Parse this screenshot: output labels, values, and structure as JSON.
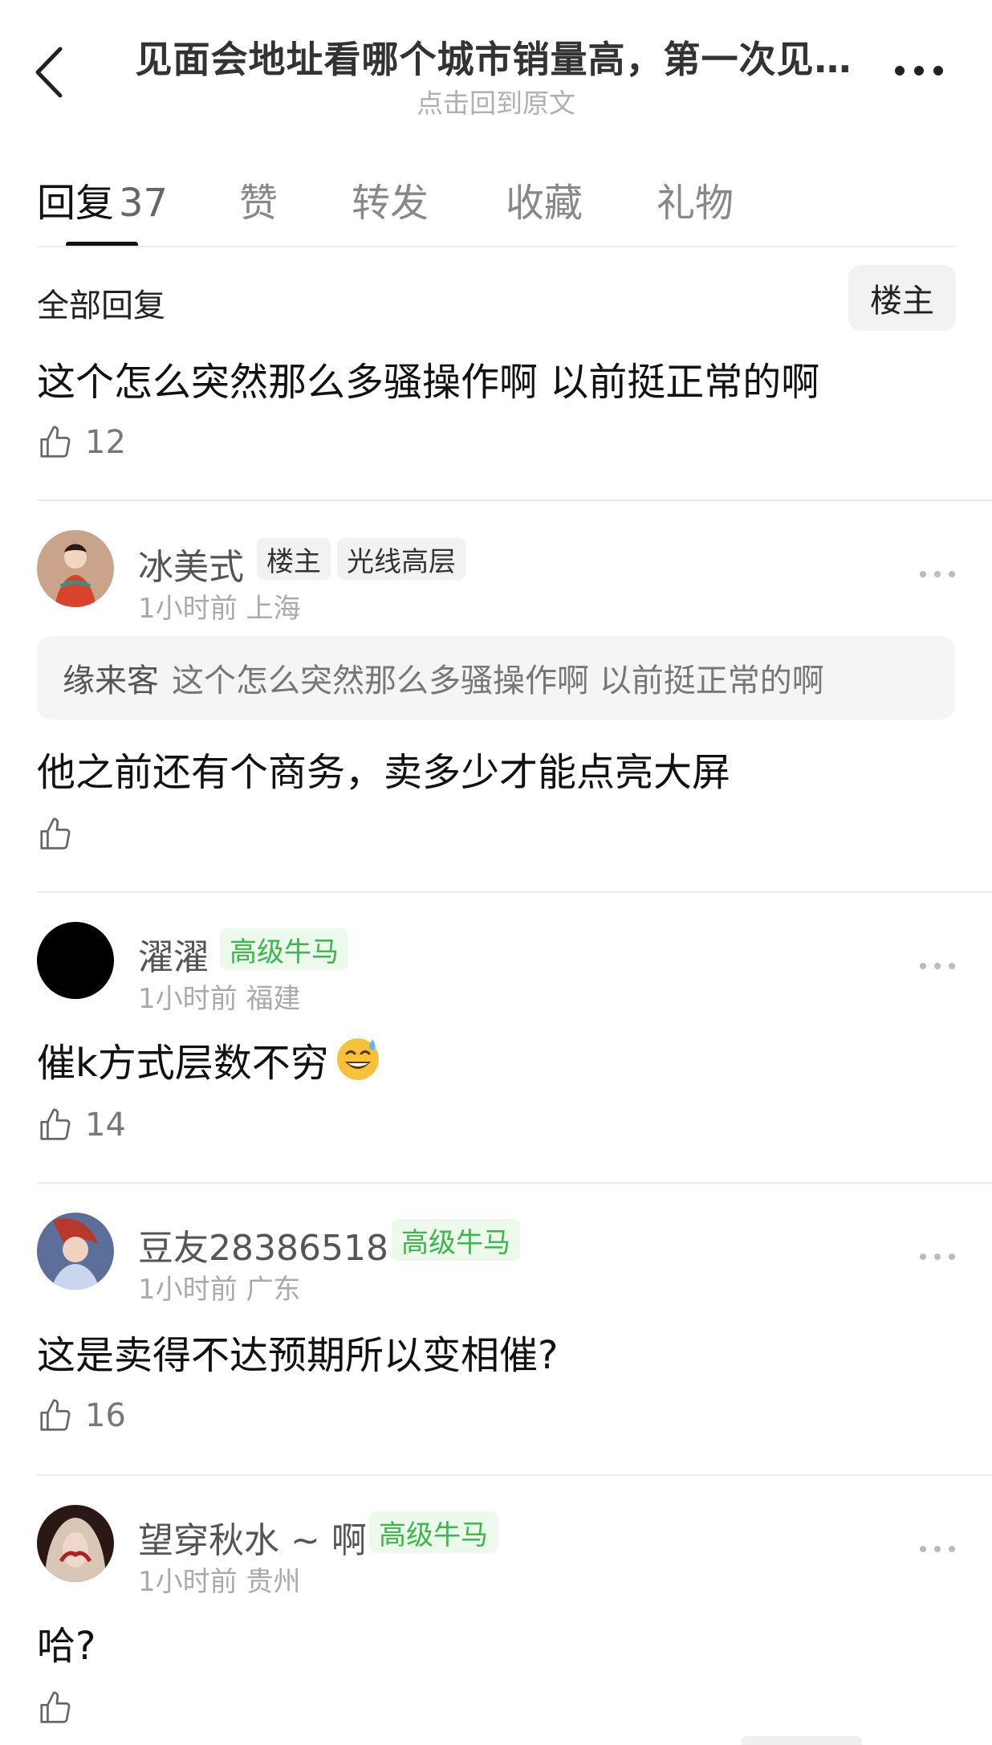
{
  "header": {
    "title": "见面会地址看哪个城市销量高，第一次见…",
    "subtitle": "点击回到原文"
  },
  "tabs": [
    {
      "label": "回复",
      "count": "37",
      "active": true
    },
    {
      "label": "赞"
    },
    {
      "label": "转发"
    },
    {
      "label": "收藏"
    },
    {
      "label": "礼物"
    }
  ],
  "filter": {
    "label": "全部回复",
    "owner_button": "楼主"
  },
  "original_comment": {
    "text": "这个怎么突然那么多骚操作啊  以前挺正常的啊",
    "likes": "12"
  },
  "replies": [
    {
      "username": "冰美式",
      "badges": [
        "楼主",
        "光线高层"
      ],
      "time": "1小时前",
      "location": "上海",
      "quote_name": "缘来客",
      "quote_text": "这个怎么突然那么多骚操作啊  以前挺正常的啊",
      "text": "他之前还有个商务，卖多少才能点亮大屏",
      "likes": ""
    },
    {
      "username": "濯濯",
      "badges": [
        "高级牛马"
      ],
      "time": "1小时前",
      "location": "福建",
      "text": "催k方式层数不穷",
      "likes": "14"
    },
    {
      "username": "豆友28386518",
      "badges": [
        "高级牛马"
      ],
      "time": "1小时前",
      "location": "广东",
      "text": "这是卖得不达预期所以变相催?",
      "likes": "16"
    },
    {
      "username": "望穿秋水 ~ 啊",
      "badges": [
        "高级牛马"
      ],
      "time": "1小时前",
      "location": "贵州",
      "text": "哈?",
      "likes": ""
    }
  ],
  "colors": {
    "badge_green": "#3ab84a",
    "badge_green_bg": "#edf9ec",
    "muted": "#aaaaaa"
  }
}
